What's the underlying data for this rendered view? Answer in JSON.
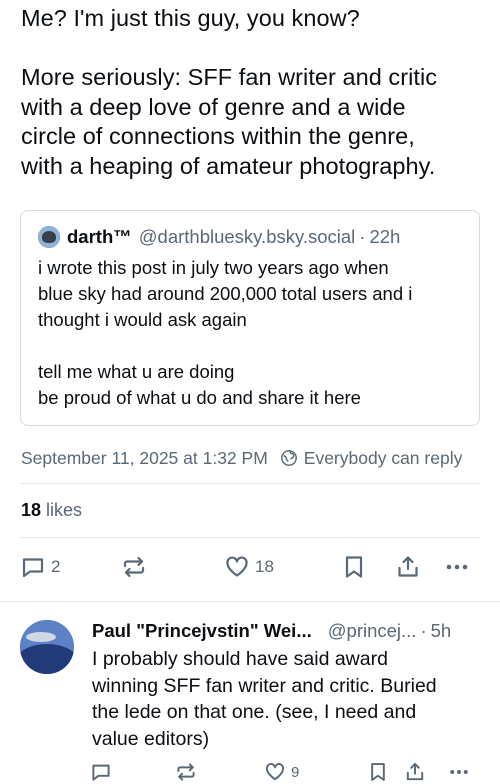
{
  "post": {
    "text_lines": [
      "Me? I'm just this guy, you know?",
      "",
      "More seriously: SFF fan writer and critic",
      "with a deep love of genre and a wide",
      "circle of connections within the genre,",
      "with a heaping of amateur photography."
    ],
    "quote": {
      "author_name": "darth™",
      "handle": "@darthbluesky.bsky.social",
      "separator": "·",
      "time": "22h",
      "text_lines": [
        "i wrote this post in july two years ago when",
        "blue sky had around 200,000 total users and i",
        "thought i would ask again",
        "",
        "tell me what u are doing",
        "be proud of what u do and share it here"
      ]
    },
    "timestamp": "September 11, 2025 at 1:32 PM",
    "reply_setting": "Everybody can reply",
    "likes_count": "18",
    "likes_label": "likes",
    "actions": {
      "reply_count": "2",
      "repost_count": "",
      "like_count": "18"
    },
    "icons": [
      "reply-icon",
      "repost-icon",
      "like-icon",
      "bookmark-icon",
      "share-icon",
      "more-icon",
      "globe-icon"
    ]
  },
  "reply": {
    "author_name": "Paul \"Princejvstin\" Wei...",
    "handle": "@princej...",
    "separator": "·",
    "time": "5h",
    "text_lines": [
      "I probably should have said award",
      "winning SFF fan writer and critic. Buried",
      "the lede on that one. (see, I need and",
      "value editors)"
    ],
    "actions": {
      "reply_count": "",
      "repost_count": "",
      "like_count": "9"
    }
  },
  "colors": {
    "text": "#0b0f14",
    "muted": "#5b6876",
    "border": "#d4dbe2",
    "divider": "#e3e8ed"
  }
}
